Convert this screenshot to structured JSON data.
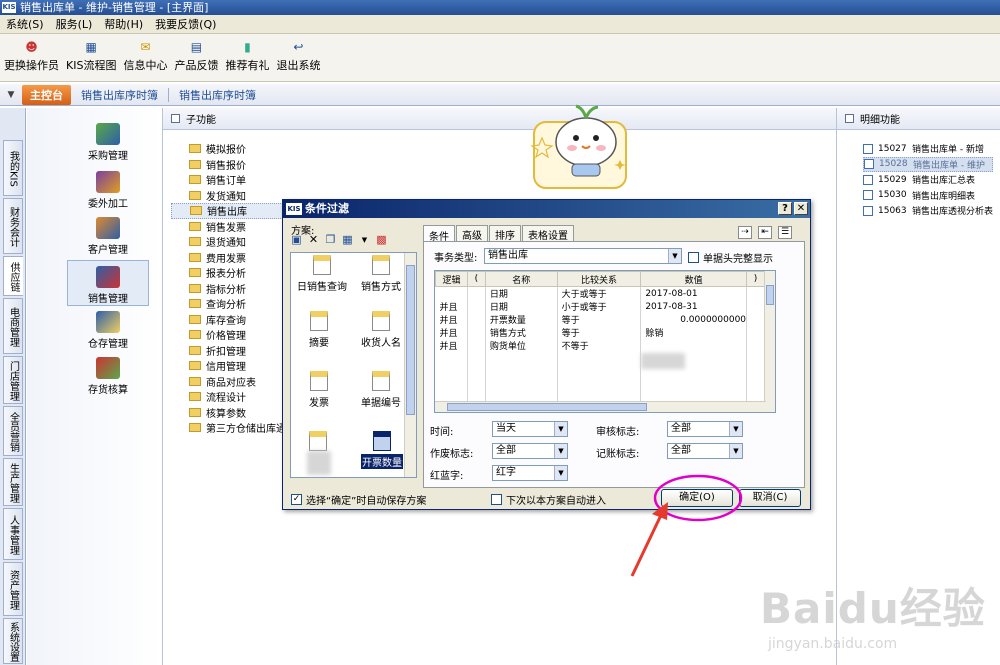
{
  "app": {
    "logo": "KIS",
    "title": "销售出库单 - 维护-销售管理 - [主界面]"
  },
  "menu": [
    "系统(S)",
    "服务(L)",
    "帮助(H)",
    "我要反馈(Q)"
  ],
  "toolbar": [
    {
      "label": "更换操作员",
      "icon": "user-switch-icon"
    },
    {
      "label": "KIS流程图",
      "icon": "flowchart-icon"
    },
    {
      "label": "信息中心",
      "icon": "message-icon"
    },
    {
      "label": "产品反馈",
      "icon": "feedback-icon"
    },
    {
      "label": "推荐有礼",
      "icon": "gift-icon"
    },
    {
      "label": "退出系统",
      "icon": "exit-icon"
    }
  ],
  "tabbar": {
    "home": "主控台",
    "tabs": [
      "销售出库序时簿",
      "销售出库序时簿"
    ]
  },
  "left_tabs": [
    "我的KIS",
    "财务会计",
    "供应链",
    "电商管理",
    "门店管理",
    "全员营销",
    "生产管理",
    "人事管理",
    "资产管理",
    "系统设置"
  ],
  "modules": [
    "采购管理",
    "委外加工",
    "客户管理",
    "销售管理",
    "仓存管理",
    "存货核算"
  ],
  "subpanel": {
    "title": "子功能",
    "items": [
      "模拟报价",
      "销售报价",
      "销售订单",
      "发货通知",
      "销售出库",
      "销售发票",
      "退货通知",
      "费用发票",
      "报表分析",
      "指标分析",
      "查询分析",
      "库存查询",
      "价格管理",
      "折扣管理",
      "信用管理",
      "商品对应表",
      "流程设计",
      "核算参数",
      "第三方仓储出库通"
    ]
  },
  "detailpanel": {
    "title": "明细功能",
    "items": [
      {
        "code": "15027",
        "label": "销售出库单 - 新增"
      },
      {
        "code": "15028",
        "label": "销售出库单 - 维护"
      },
      {
        "code": "15029",
        "label": "销售出库汇总表"
      },
      {
        "code": "15030",
        "label": "销售出库明细表"
      },
      {
        "code": "15063",
        "label": "销售出库透视分析表"
      }
    ]
  },
  "dialog": {
    "logo": "KIS",
    "title": "条件过滤",
    "help": "?",
    "close": "✕",
    "scheme_label": "方案:",
    "schemes": [
      "日销售查询",
      "销售方式",
      "摘要",
      "收货人名",
      "发票",
      "单据编号",
      "开票数量"
    ],
    "tabs": [
      "条件",
      "高级",
      "排序",
      "表格设置"
    ],
    "business_type_label": "事务类型:",
    "business_type_value": "销售出库",
    "single_header_label": "单据头完整显示",
    "grid_headers": [
      "逻辑",
      "(",
      "名称",
      "比较关系",
      "数值",
      ")"
    ],
    "grid_rows": [
      {
        "logic": "",
        "name": "日期",
        "op": "大于或等于",
        "value": "2017-08-01"
      },
      {
        "logic": "并且",
        "name": "日期",
        "op": "小于或等于",
        "value": "2017-08-31"
      },
      {
        "logic": "并且",
        "name": "开票数量",
        "op": "等于",
        "value": "0.0000000000"
      },
      {
        "logic": "并且",
        "name": "销售方式",
        "op": "等于",
        "value": "赊销"
      },
      {
        "logic": "并且",
        "name": "购货单位",
        "op": "不等于",
        "value": ""
      }
    ],
    "time_label": "时间:",
    "time_value": "当天",
    "audit_label": "审核标志:",
    "audit_value": "全部",
    "void_label": "作废标志:",
    "void_value": "全部",
    "post_label": "记账标志:",
    "post_value": "全部",
    "redblue_label": "红蓝字:",
    "redblue_value": "红字",
    "save_scheme_label": "选择“确定”时自动保存方案",
    "auto_enter_label": "下次以本方案自动进入",
    "ok_label": "确定(O)",
    "cancel_label": "取消(C)"
  },
  "watermark": {
    "main": "Baidu经验",
    "sub": "jingyan.baidu.com"
  },
  "colors": {
    "title": "#254f93",
    "accent": "#d35f16",
    "highlight": "#e000c8",
    "arrow": "#e53b2c"
  }
}
